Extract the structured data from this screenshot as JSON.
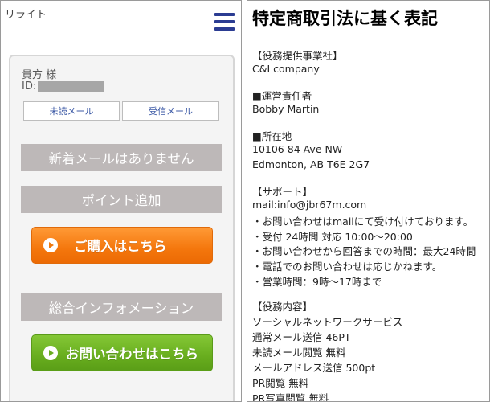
{
  "left_panel": {
    "app_title": "リライト",
    "user_name": "貴方 様",
    "user_id_label": "ID:",
    "unread_mail_label": "未読メール",
    "received_mail_label": "受信メール",
    "no_new_mail_text": "新着メールはありません",
    "add_points_label": "ポイント追加",
    "buy_button_label": "ご購入はこちら",
    "general_info_label": "総合インフォメーション",
    "contact_button_label": "お問い合わせはこちら",
    "colors": {
      "menu": "#2b3c92",
      "buy": "#f4770d",
      "contact": "#68ad1e",
      "grey_bar": "#bdb8b8"
    }
  },
  "right_panel": {
    "title": "特定商取引法に基く表記",
    "lines": [
      "【役務提供事業社】",
      "C&I company",
      "■運営責任者",
      "Bobby Martin",
      "■所在地",
      "10106 84 Ave NW",
      "Edmonton, AB T6E 2G7",
      "【サポート】",
      "mail:info@jbr67m.com",
      "・お問い合わせはmailにて受け付けております。",
      "・受付 24時間 対応 10:00～20:00",
      "・お問い合わせから回答までの時間：最大24時間",
      "・電話でのお問い合わせは応じかねます。",
      "・営業時間：9時～17時まで",
      "【役務内容】",
      "ソーシャルネットワークサービス",
      "通常メール送信 46PT",
      "未読メール閲覧 無料",
      "メールアドレス送信 500pt",
      "PR閲覧 無料",
      "PR写真閲覧 無料"
    ]
  }
}
